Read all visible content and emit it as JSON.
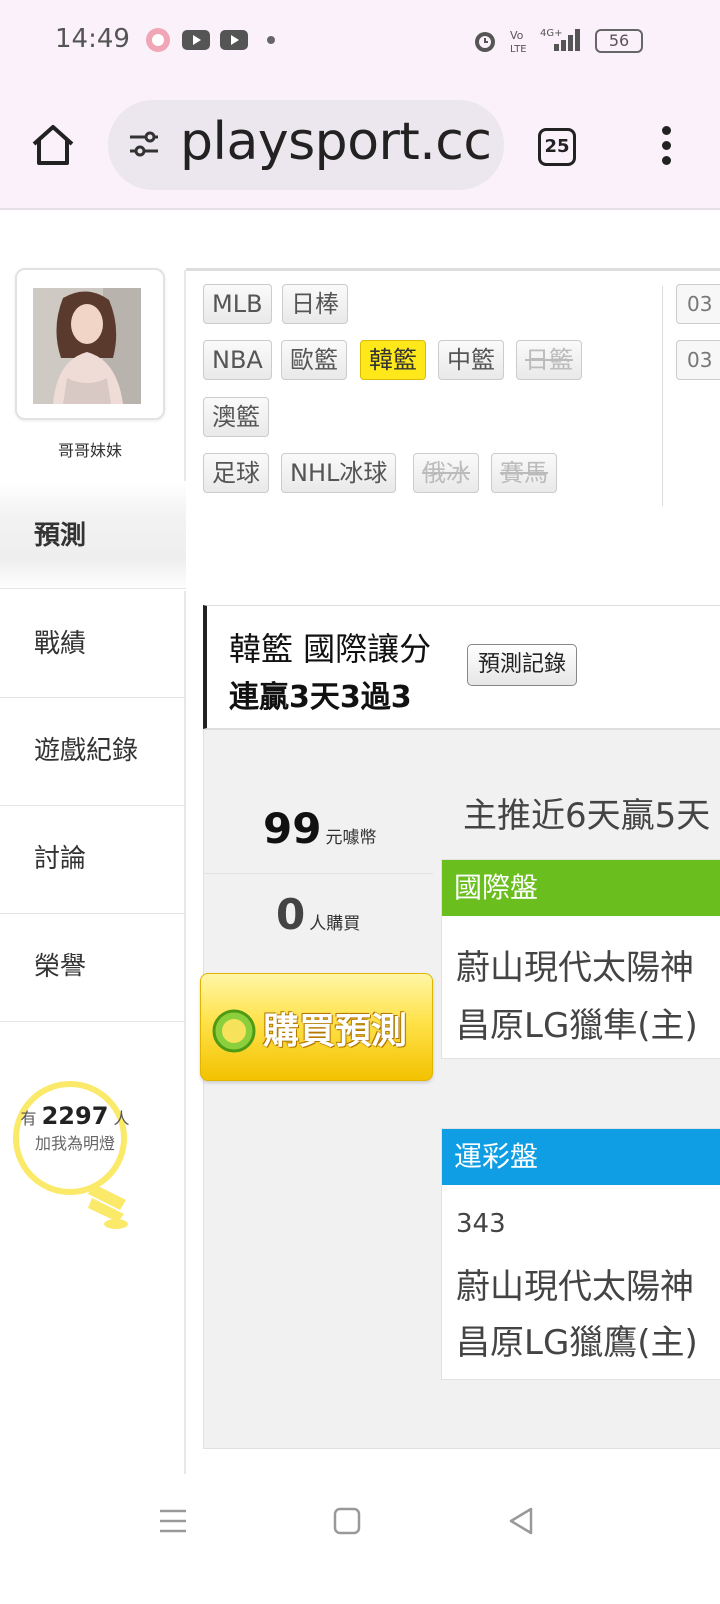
{
  "status_bar": {
    "time": "14:49",
    "battery": "56"
  },
  "browser": {
    "url": "playsport.cc",
    "tab_count": "25"
  },
  "profile": {
    "name": "哥哥妹妹"
  },
  "sidebar": {
    "items": [
      {
        "label": "預測",
        "active": true
      },
      {
        "label": "戰績"
      },
      {
        "label": "遊戲紀錄"
      },
      {
        "label": "討論"
      },
      {
        "label": "榮譽"
      }
    ]
  },
  "fans": {
    "prefix": "有",
    "count": "2297",
    "suffix": "人",
    "text": "加我為明燈"
  },
  "sport_tabs": {
    "row1": [
      "MLB",
      "日棒"
    ],
    "row2": [
      "NBA",
      "歐籃",
      "韓籃",
      "中籃",
      "日籃"
    ],
    "row3": [
      "澳籃"
    ],
    "row4": [
      "足球",
      "NHL冰球",
      "俄冰",
      "賽馬"
    ],
    "active": "韓籃",
    "dates": [
      "03",
      "03"
    ]
  },
  "prediction": {
    "title": "韓籃 國際讓分",
    "subtitle": "連贏3天3過3",
    "record_button": "預測記錄",
    "price_value": "99",
    "price_unit": "元噱幣",
    "buyers_value": "0",
    "buyers_unit": "人購買",
    "buy_button": "購買預測",
    "streak": "主推近6天贏5天"
  },
  "cards": [
    {
      "header": "國際盤",
      "color": "#6abf1e",
      "lines": [
        "蔚山現代太陽神",
        "昌原LG獵隼(主)"
      ]
    },
    {
      "header": "運彩盤",
      "color": "#0f9ee4",
      "number": "343",
      "lines": [
        "蔚山現代太陽神",
        "昌原LG獵鷹(主)"
      ]
    }
  ]
}
